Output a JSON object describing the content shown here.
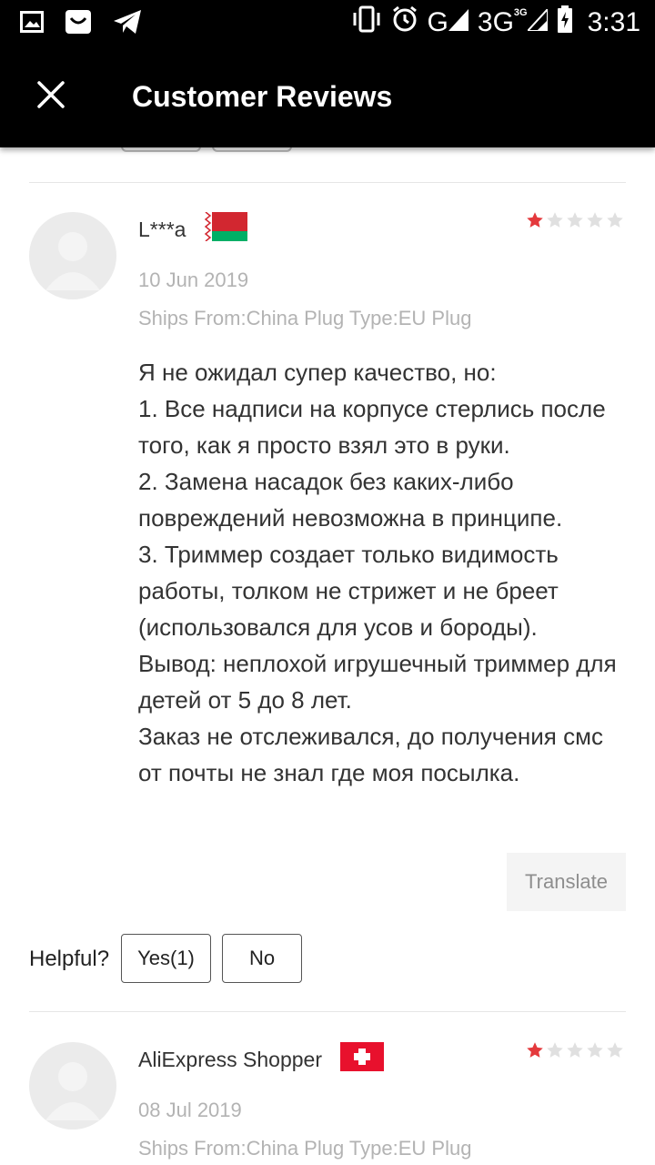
{
  "status_bar": {
    "network_g": "G",
    "network_3g": "3G",
    "network_3g_small": "3G",
    "time": "3:31",
    "icons": [
      "gallery-icon",
      "mail-icon",
      "telegram-icon",
      "vibrate-icon",
      "alarm-icon",
      "signal-icon",
      "battery-icon"
    ]
  },
  "app_bar": {
    "title": "Customer Reviews",
    "close_icon": "close-icon"
  },
  "reviews": [
    {
      "name": "L***a",
      "flag": "belarus-flag",
      "rating": 1,
      "max_rating": 5,
      "date": "10 Jun 2019",
      "ships": "Ships From:China Plug Type:EU Plug",
      "text": "Я не ожидал супер качество, но:\n1. Все надписи на корпусе стерлись после того, как я просто взял это в руки.\n2. Замена насадок без каких-либо повреждений невозможна в принципе.\n3. Триммер создает только видимость работы, толком не стрижет и не бреет (использовался для усов и бороды).\nВывод: неплохой игрушечный триммер для детей от 5 до 8 лет.\nЗаказ не отслеживался, до получения смс от почты не знал где моя посылка.",
      "translate_label": "Translate",
      "helpful_label": "Helpful?",
      "yes_label": "Yes(1)",
      "no_label": "No"
    },
    {
      "name": "AliExpress Shopper",
      "flag": "switzerland-flag",
      "rating": 1,
      "max_rating": 5,
      "date": "08 Jul 2019",
      "ships": "Ships From:China Plug Type:EU Plug"
    }
  ],
  "colors": {
    "star_filled": "#e4393c",
    "star_empty": "#e0e0e0",
    "header_bg": "#000000",
    "muted_text": "#b3b3b3"
  }
}
